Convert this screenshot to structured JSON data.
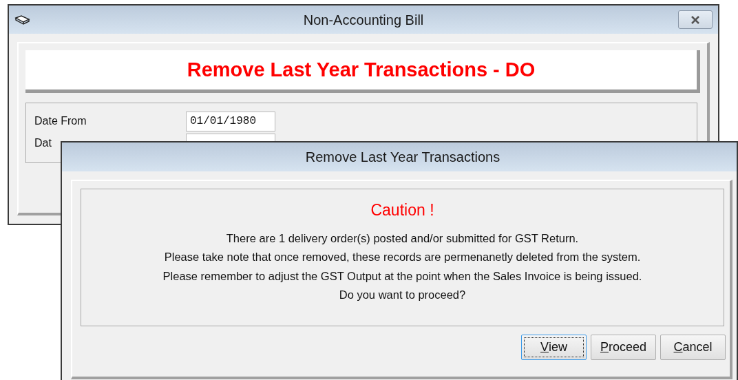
{
  "back_window": {
    "title": "Non-Accounting Bill",
    "heading": "Remove Last Year Transactions - DO",
    "fields": [
      {
        "label": "Date From",
        "value": "01/01/1980"
      },
      {
        "label": "Dat"
      }
    ]
  },
  "dialog": {
    "title": "Remove Last Year Transactions",
    "caution": "Caution !",
    "lines": [
      "There are 1 delivery order(s) posted and/or submitted for GST Return.",
      "Please take note that once removed, these records are permenanetly deleted from the system.",
      "Please remember to adjust the GST Output at the point when the Sales Invoice is being issued.",
      "Do you want to proceed?"
    ],
    "buttons": [
      {
        "access_key": "V",
        "rest": "iew",
        "focused": true
      },
      {
        "access_key": "P",
        "rest": "roceed",
        "focused": false
      },
      {
        "access_key": "C",
        "rest": "ancel",
        "focused": false
      }
    ]
  }
}
